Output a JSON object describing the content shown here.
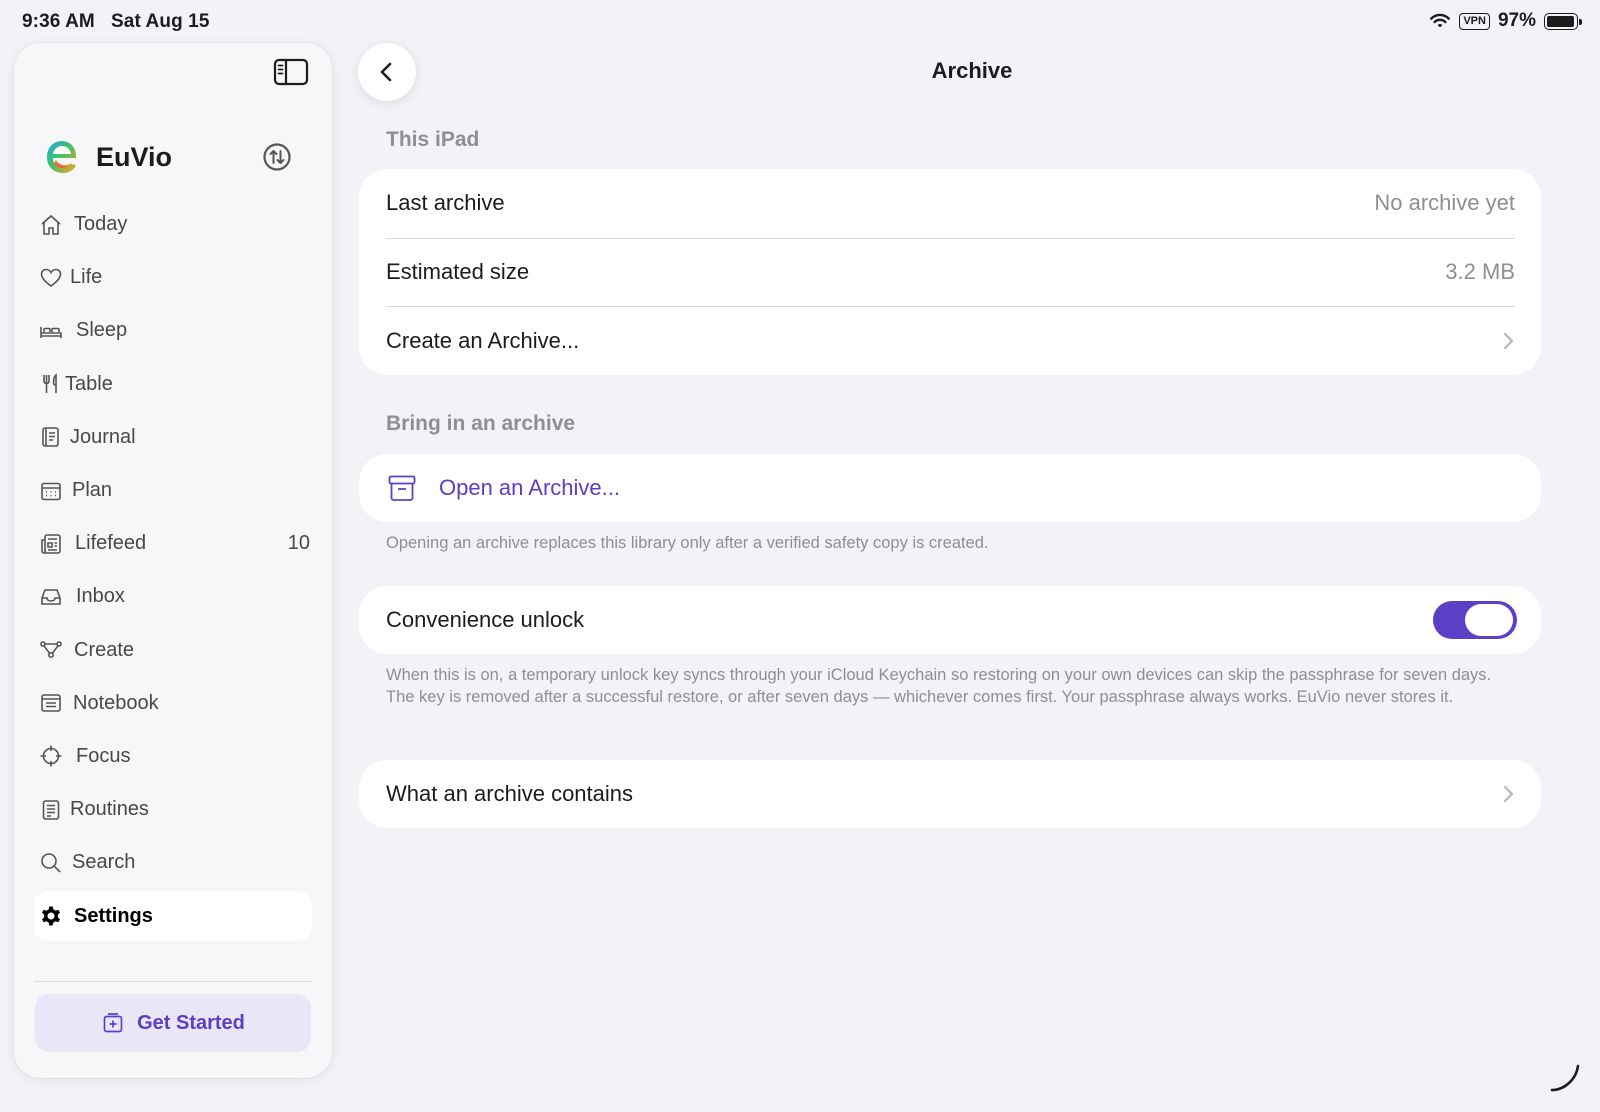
{
  "status_bar": {
    "time": "9:36 AM",
    "date": "Sat Aug 15",
    "vpn": "VPN",
    "battery": "97%",
    "battery_level": 0.97
  },
  "sidebar": {
    "brand": "EuVio",
    "items": [
      {
        "label": "Today",
        "icon": "house-icon"
      },
      {
        "label": "Life",
        "icon": "heart-icon"
      },
      {
        "label": "Sleep",
        "icon": "bed-icon"
      },
      {
        "label": "Table",
        "icon": "fork-knife-icon"
      },
      {
        "label": "Journal",
        "icon": "journal-icon"
      },
      {
        "label": "Plan",
        "icon": "calendar-icon"
      },
      {
        "label": "Lifefeed",
        "icon": "newspaper-icon",
        "count": "10"
      },
      {
        "label": "Inbox",
        "icon": "tray-icon"
      },
      {
        "label": "Create",
        "icon": "nodes-icon"
      },
      {
        "label": "Notebook",
        "icon": "notebook-icon"
      },
      {
        "label": "Focus",
        "icon": "scope-icon"
      },
      {
        "label": "Routines",
        "icon": "checklist-icon"
      },
      {
        "label": "Search",
        "icon": "search-icon"
      },
      {
        "label": "Settings",
        "icon": "gear-icon",
        "active": true
      }
    ],
    "get_started": "Get Started"
  },
  "main": {
    "title": "Archive",
    "this_ipad": {
      "header": "This iPad",
      "last_archive_label": "Last archive",
      "last_archive_value": "No archive yet",
      "estimated_size_label": "Estimated size",
      "estimated_size_value": "3.2 MB",
      "create_label": "Create an Archive..."
    },
    "bring_in": {
      "header": "Bring in an archive",
      "open_label": "Open an Archive...",
      "footnote": "Opening an archive replaces this library only after a verified safety copy is created."
    },
    "convenience": {
      "label": "Convenience unlock",
      "enabled": true,
      "footnote": "When this is on, a temporary unlock key syncs through your iCloud Keychain so restoring on your own devices can skip the passphrase for seven days. The key is removed after a successful restore, or after seven days — whichever comes first. Your passphrase always works. EuVio never stores it."
    },
    "contains_label": "What an archive contains"
  },
  "colors": {
    "accent": "#5b3fc4",
    "background": "#f2f2f7",
    "secondary_text": "#8e8e93"
  }
}
